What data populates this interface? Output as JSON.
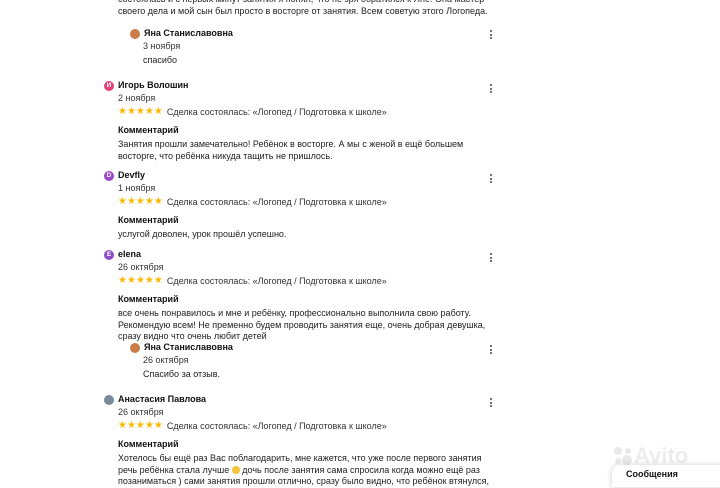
{
  "top_text": "состоялась и с первых минут занятия я понял, что не зря обратился к Яне! Она мастер своего дела и мой сын был просто в восторге от занятия. Всем советую этого Логопеда.",
  "reviews": [
    {
      "reply": {
        "name": "Яна Станиславовна",
        "date": "3 ноября",
        "text": "спасибо"
      }
    },
    {
      "initial": "И",
      "avatar_color": "#e8407a",
      "name": "Игорь Волошин",
      "date": "2 ноября",
      "stars": "★★★★★",
      "deal": "Сделка состоялась: «Логопед / Подготовка к школе»",
      "comment_title": "Комментарий",
      "comment": "Занятия прошли замечательно! Ребёнок в восторге. А мы с женой в ещё большем восторге, что ребёнка никуда тащить не пришлось."
    },
    {
      "initial": "D",
      "avatar_color": "#9b46c8",
      "name": "Devfly",
      "date": "1 ноября",
      "stars": "★★★★★",
      "deal": "Сделка состоялась: «Логопед / Подготовка к школе»",
      "comment_title": "Комментарий",
      "comment": "услугой доволен, урок прошёл успешно."
    },
    {
      "initial": "E",
      "avatar_color": "#8f4fc6",
      "name": "elena",
      "date": "26 октября",
      "stars": "★★★★★",
      "deal": "Сделка состоялась: «Логопед / Подготовка к школе»",
      "comment_title": "Комментарий",
      "comment": "все очень понравилось и мне и ребёнку, профессионально выполнила свою работу. Рекомендую всем! Не пременно будем проводить занятия еще, очень добрая девушка, сразу видно что очень любит детей",
      "reply": {
        "name": "Яна Станиславовна",
        "date": "26 октября",
        "text": "Спасибо за отзыв."
      }
    },
    {
      "name": "Анастасия Павлова",
      "date": "26 октября",
      "stars": "★★★★★",
      "deal": "Сделка состоялась: «Логопед / Подготовка к школе»",
      "comment_title": "Комментарий",
      "comment_a": "Хотелось бы ещё раз Вас поблагодарить, мне кажется, что уже после первого занятия речь ребёнка стала лучше",
      "comment_b": "дочь после занятия сама спросила когда можно ещё раз позаниматься ) сами занятия прошли отлично, сразу было видно, что ребёнок втянулся,"
    }
  ],
  "watermark": "Avito",
  "messages_label": "Сообщения",
  "colors": {
    "star": "#ffb800"
  }
}
